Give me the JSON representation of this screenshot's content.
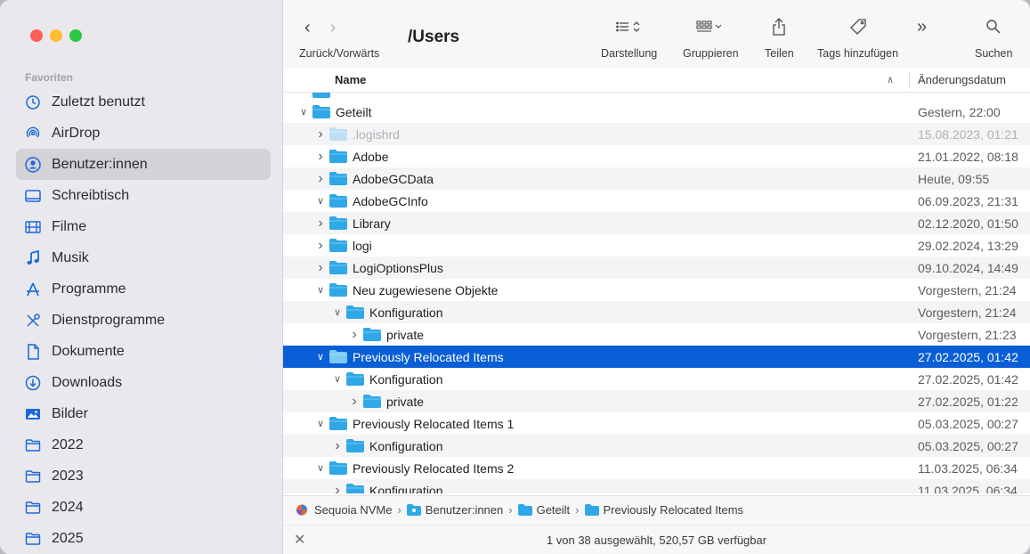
{
  "toolbar": {
    "nav_label": "Zurück/Vorwärts",
    "title": "/Users",
    "darstellung": "Darstellung",
    "gruppieren": "Gruppieren",
    "teilen": "Teilen",
    "tags": "Tags hinzufügen",
    "suchen": "Suchen"
  },
  "sidebar": {
    "section": "Favoriten",
    "items": [
      {
        "label": "Zuletzt benutzt",
        "icon": "clock-icon"
      },
      {
        "label": "AirDrop",
        "icon": "airdrop-icon"
      },
      {
        "label": "Benutzer:innen",
        "icon": "user-icon",
        "active": true
      },
      {
        "label": "Schreibtisch",
        "icon": "desktop-icon"
      },
      {
        "label": "Filme",
        "icon": "film-icon"
      },
      {
        "label": "Musik",
        "icon": "music-icon"
      },
      {
        "label": "Programme",
        "icon": "apps-icon"
      },
      {
        "label": "Dienstprogramme",
        "icon": "tools-icon"
      },
      {
        "label": "Dokumente",
        "icon": "document-icon"
      },
      {
        "label": "Downloads",
        "icon": "download-icon"
      },
      {
        "label": "Bilder",
        "icon": "photo-icon"
      },
      {
        "label": "2022",
        "icon": "folder-icon"
      },
      {
        "label": "2023",
        "icon": "folder-icon"
      },
      {
        "label": "2024",
        "icon": "folder-icon"
      },
      {
        "label": "2025",
        "icon": "folder-icon"
      }
    ]
  },
  "columns": {
    "name": "Name",
    "date": "Änderungsdatum"
  },
  "rows": [
    {
      "name": "Geteilt",
      "date": "Gestern, 22:00",
      "level": 0,
      "expanded": true
    },
    {
      "name": ".logishrd",
      "date": "15.08.2023, 01:21",
      "level": 1,
      "expanded": false,
      "faded": true
    },
    {
      "name": "Adobe",
      "date": "21.01.2022, 08:18",
      "level": 1,
      "expanded": false
    },
    {
      "name": "AdobeGCData",
      "date": "Heute, 09:55",
      "level": 1,
      "expanded": false
    },
    {
      "name": "AdobeGCInfo",
      "date": "06.09.2023, 21:31",
      "level": 1,
      "expanded": true
    },
    {
      "name": "Library",
      "date": "02.12.2020, 01:50",
      "level": 1,
      "expanded": false
    },
    {
      "name": "logi",
      "date": "29.02.2024, 13:29",
      "level": 1,
      "expanded": false
    },
    {
      "name": "LogiOptionsPlus",
      "date": "09.10.2024, 14:49",
      "level": 1,
      "expanded": false
    },
    {
      "name": "Neu zugewiesene Objekte",
      "date": "Vorgestern, 21:24",
      "level": 1,
      "expanded": true
    },
    {
      "name": "Konfiguration",
      "date": "Vorgestern, 21:24",
      "level": 2,
      "expanded": true
    },
    {
      "name": "private",
      "date": "Vorgestern, 21:23",
      "level": 3,
      "expanded": false
    },
    {
      "name": "Previously Relocated Items",
      "date": "27.02.2025, 01:42",
      "level": 1,
      "expanded": true,
      "selected": true
    },
    {
      "name": "Konfiguration",
      "date": "27.02.2025, 01:42",
      "level": 2,
      "expanded": true
    },
    {
      "name": "private",
      "date": "27.02.2025, 01:22",
      "level": 3,
      "expanded": false
    },
    {
      "name": "Previously Relocated Items 1",
      "date": "05.03.2025, 00:27",
      "level": 1,
      "expanded": true
    },
    {
      "name": "Konfiguration",
      "date": "05.03.2025, 00:27",
      "level": 2,
      "expanded": false
    },
    {
      "name": "Previously Relocated Items 2",
      "date": "11.03.2025, 06:34",
      "level": 1,
      "expanded": true
    },
    {
      "name": "Konfiguration",
      "date": "11.03.2025, 06:34",
      "level": 2,
      "expanded": false
    }
  ],
  "pathbar": [
    "Sequoia NVMe",
    "Benutzer:innen",
    "Geteilt",
    "Previously Relocated Items"
  ],
  "status": "1 von 38 ausgewählt, 520,57 GB verfügbar",
  "colors": {
    "accent": "#0a5fd6",
    "folder": "#2fa8e8"
  }
}
